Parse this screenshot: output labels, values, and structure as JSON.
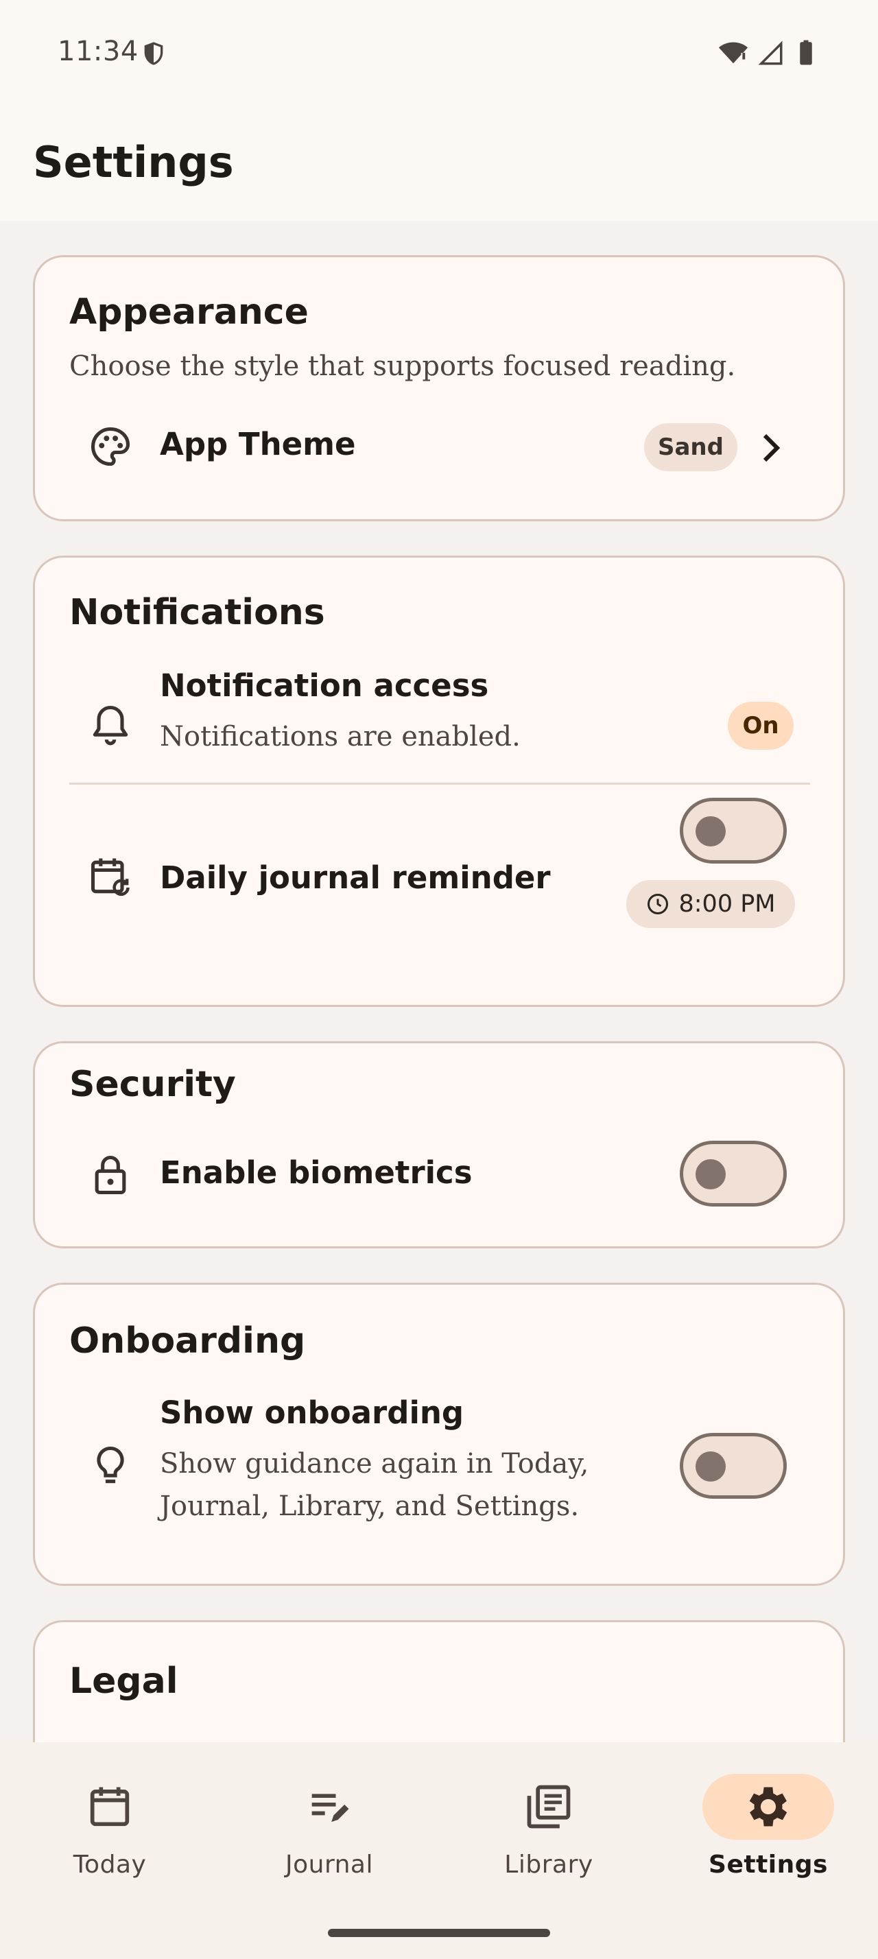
{
  "status_bar": {
    "time": "11:34",
    "icons": [
      "shield-icon",
      "wifi-icon",
      "signal-icon",
      "battery-icon"
    ]
  },
  "header": {
    "title": "Settings"
  },
  "sections": {
    "appearance": {
      "title": "Appearance",
      "subtitle": "Choose the style that supports focused reading.",
      "theme_label": "App Theme",
      "theme_value": "Sand"
    },
    "notifications": {
      "title": "Notifications",
      "access_label": "Notification access",
      "access_desc": "Notifications are enabled.",
      "access_badge": "On",
      "reminder_label": "Daily journal reminder",
      "reminder_time": "8:00 PM",
      "reminder_enabled": false
    },
    "security": {
      "title": "Security",
      "biometrics_label": "Enable biometrics",
      "biometrics_enabled": false
    },
    "onboarding": {
      "title": "Onboarding",
      "show_label": "Show onboarding",
      "show_desc_line1": "Show guidance again in Today,",
      "show_desc_line2": "Journal, Library, and Settings.",
      "show_enabled": false
    },
    "legal": {
      "title": "Legal"
    }
  },
  "bottom_nav": {
    "items": [
      {
        "label": "Today",
        "icon": "calendar-icon",
        "active": false
      },
      {
        "label": "Journal",
        "icon": "edit-notes-icon",
        "active": false
      },
      {
        "label": "Library",
        "icon": "library-icon",
        "active": false
      },
      {
        "label": "Settings",
        "icon": "gear-icon",
        "active": true
      }
    ]
  },
  "colors": {
    "background": "#f5f1ee",
    "card": "#fff8f5",
    "card_border": "#d8c6bd",
    "accent": "#ffdcc0",
    "chip": "#f0e0d6",
    "text": "#1f1b18"
  }
}
